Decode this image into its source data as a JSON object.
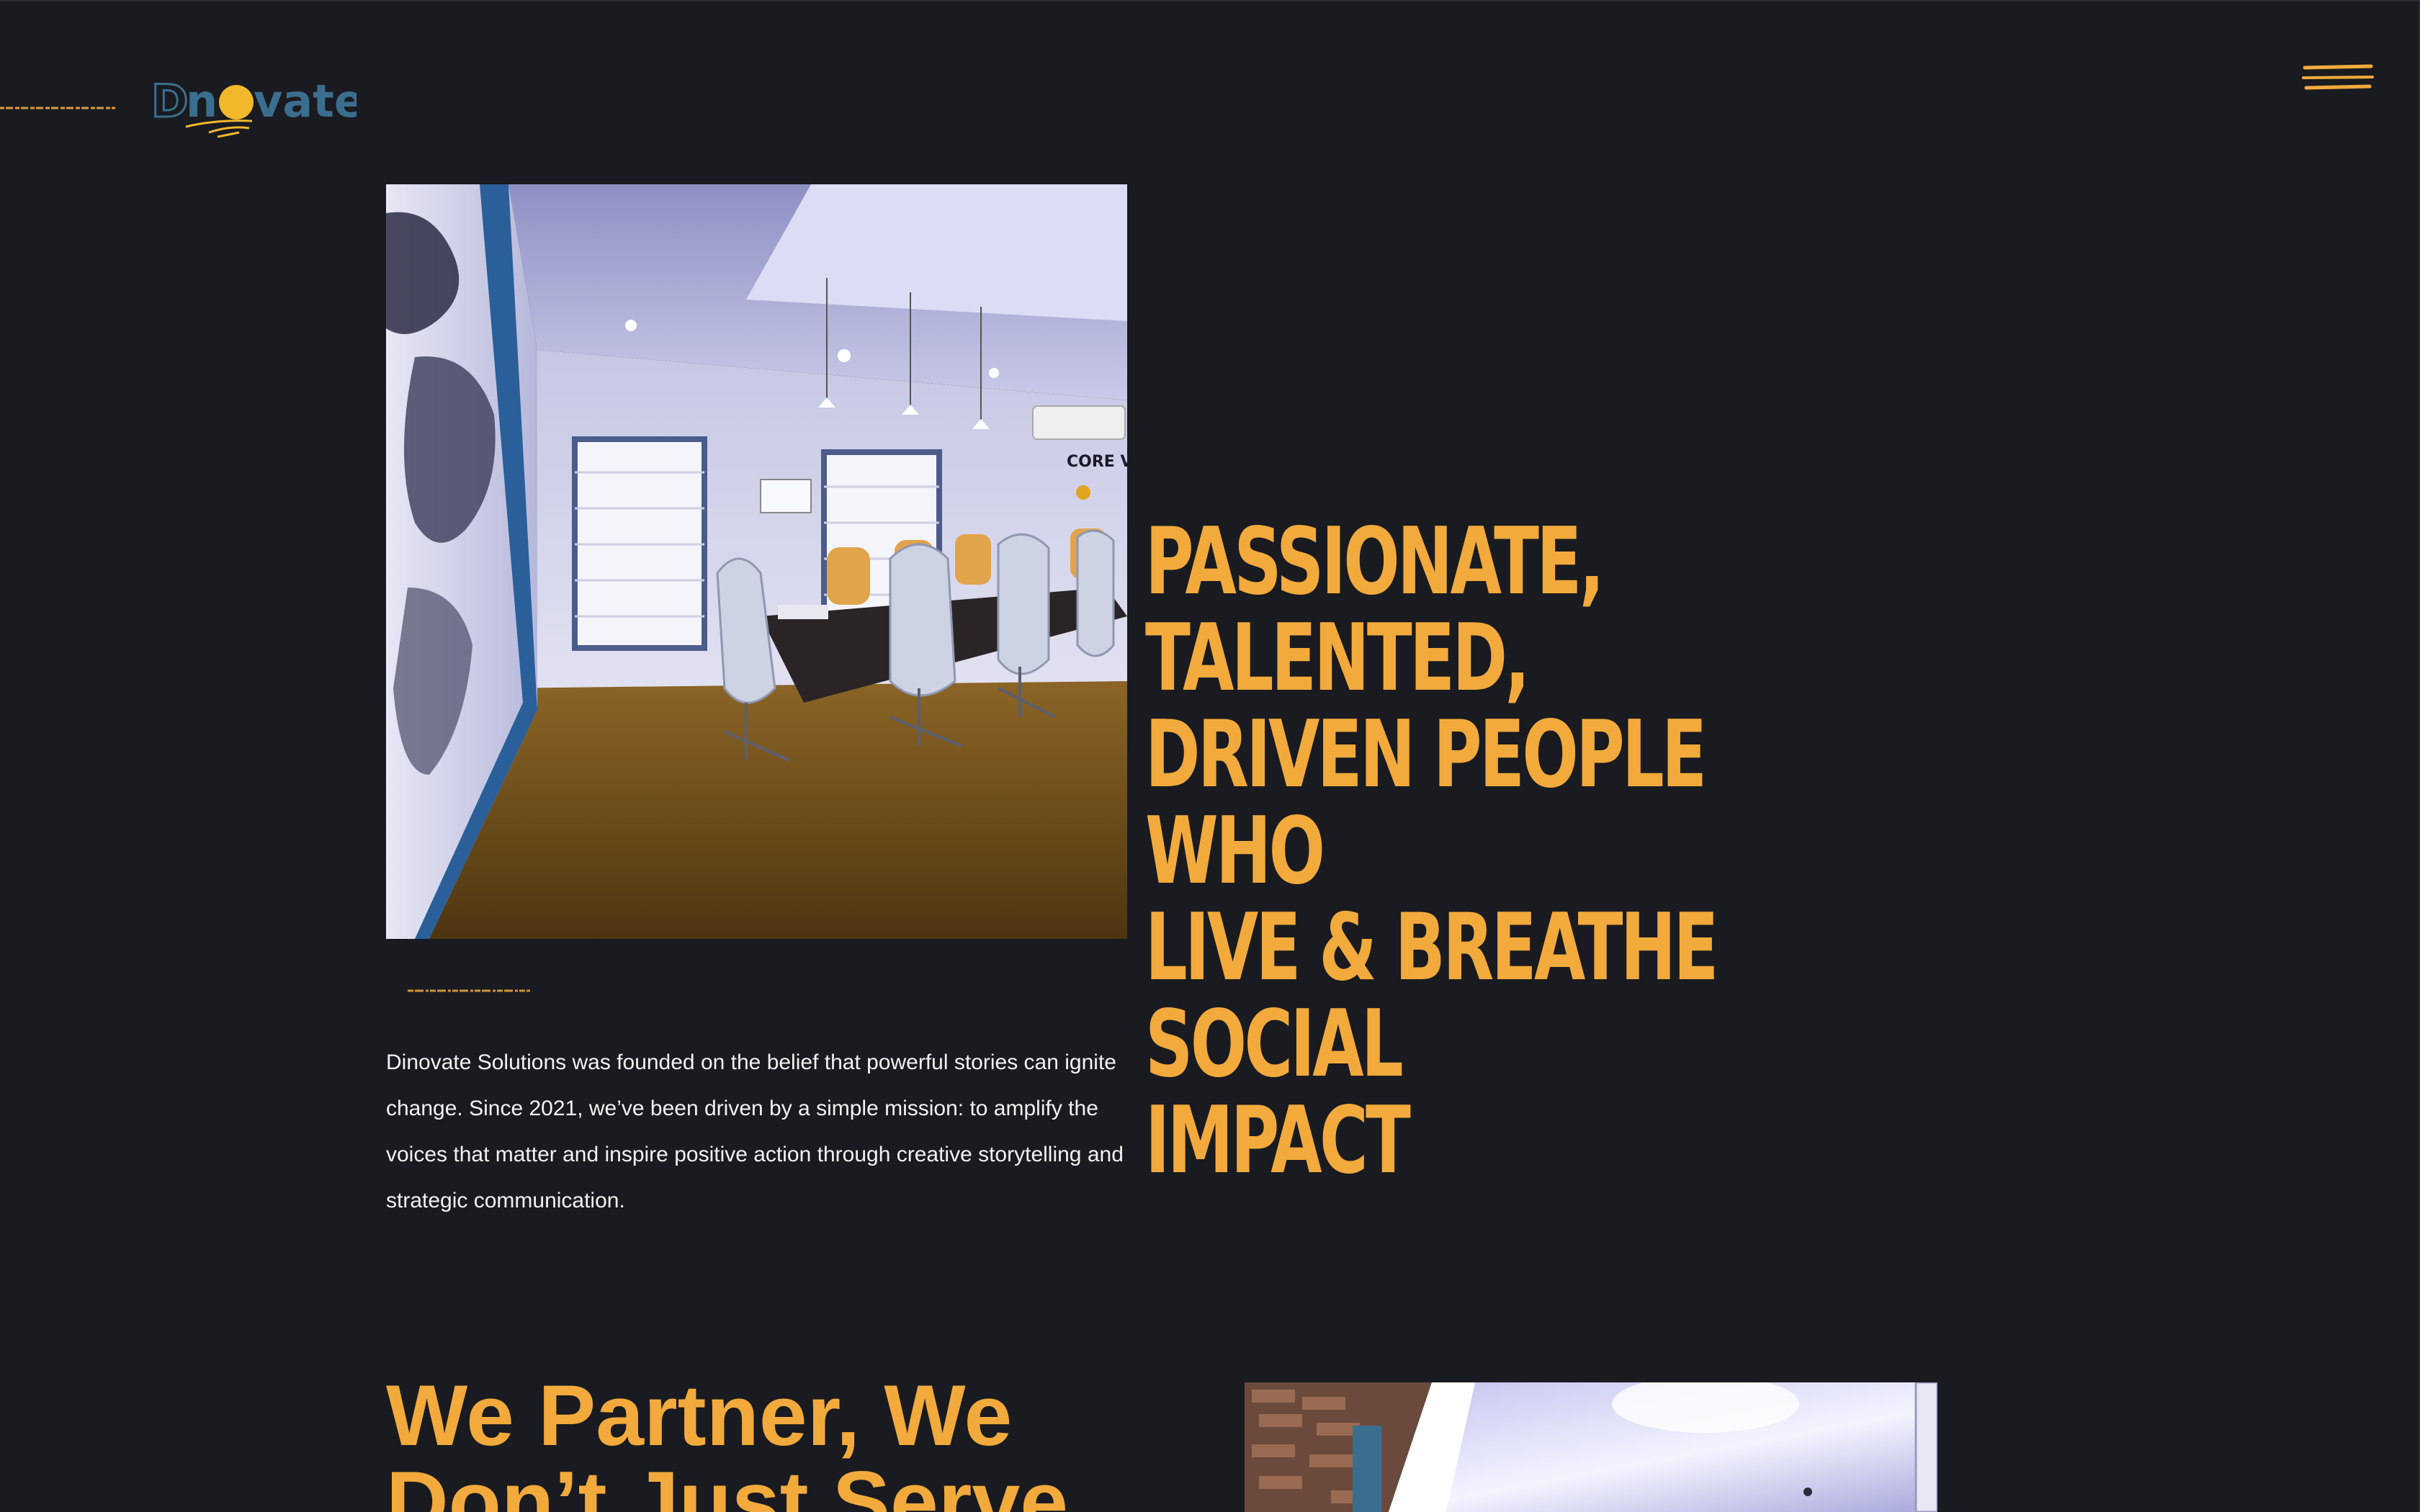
{
  "header": {
    "logo_text": "Dinovate",
    "menu_icon": "hamburger-menu-icon"
  },
  "hero": {
    "photo_alt": "Conference room with white office chairs and world map wall",
    "wall_sign": "CORE V",
    "title": "PASSIONATE, TALENTED,\nDRIVEN PEOPLE WHO\nLIVE & BREATHE SOCIAL\nIMPACT",
    "intro": "Dinovate Solutions was founded on the belief that powerful stories can ignite change. Since 2021, we’ve been driven by a simple mission: to amplify the voices that matter and inspire positive action through creative storytelling and strategic communication."
  },
  "partner": {
    "title": "We Partner, We Don’t Just Serve"
  },
  "colors": {
    "background": "#191b20",
    "accent": "#f2aa3c",
    "logo_blue": "#3b6e8e",
    "text": "#f2f2f2"
  }
}
